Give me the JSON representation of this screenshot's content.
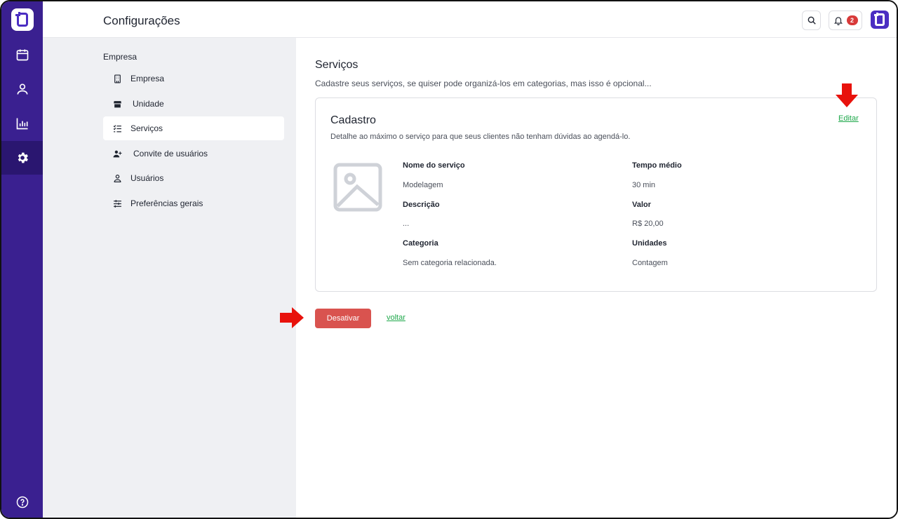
{
  "header": {
    "title": "Configurações",
    "notification_count": "2"
  },
  "menu": {
    "section": "Empresa",
    "items": [
      {
        "label": "Empresa"
      },
      {
        "label": "Unidade"
      },
      {
        "label": "Serviços"
      },
      {
        "label": "Convite de usuários"
      },
      {
        "label": "Usuários"
      },
      {
        "label": "Preferências gerais"
      }
    ]
  },
  "main": {
    "title": "Serviços",
    "subtitle": "Cadastre seus serviços, se quiser pode organizá-los em categorias, mas isso é opcional..."
  },
  "card": {
    "title": "Cadastro",
    "subtitle": "Detalhe ao máximo o serviço para que seus clientes não tenham dúvidas ao agendá-lo.",
    "edit_label": "Editar",
    "fields": {
      "service_name_label": "Nome do serviço",
      "service_name_value": "Modelagem",
      "avg_time_label": "Tempo médio",
      "avg_time_value": "30 min",
      "description_label": "Descrição",
      "description_value": "...",
      "price_label": "Valor",
      "price_value": "R$ 20,00",
      "category_label": "Categoria",
      "category_value": "Sem categoria relacionada.",
      "units_label": "Unidades",
      "units_value": "Contagem"
    }
  },
  "actions": {
    "deactivate_label": "Desativar",
    "back_label": "voltar"
  },
  "colors": {
    "rail": "#3a2090",
    "rail_active": "#2a1670",
    "brand": "#4b2ec2",
    "link_green": "#1ea84a",
    "danger": "#d9534f",
    "annotation_arrow": "#e8120c"
  },
  "icons": {
    "rail": [
      "calendar-icon",
      "user-icon",
      "chart-icon",
      "gear-icon",
      "help-icon"
    ],
    "menu": [
      "building-icon",
      "store-icon",
      "list-check-icon",
      "user-plus-icon",
      "user-icon",
      "sliders-icon"
    ]
  }
}
